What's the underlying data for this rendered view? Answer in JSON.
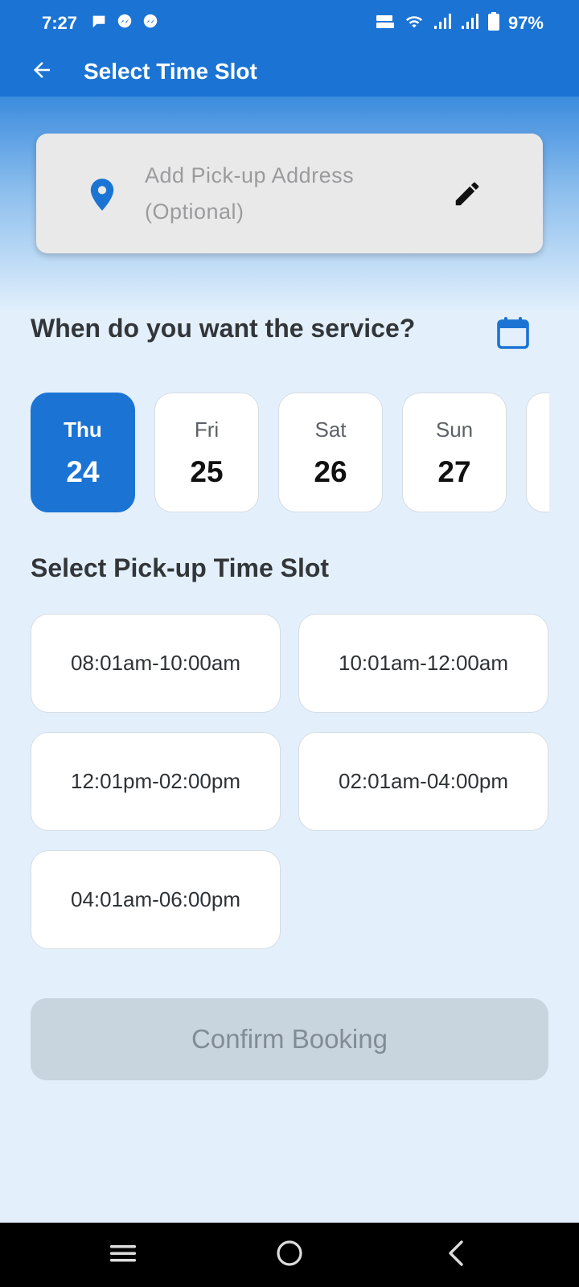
{
  "status_bar": {
    "time": "7:27",
    "battery": "97%",
    "left_icons": [
      "chat-bubble-icon",
      "messenger-icon",
      "messenger-icon"
    ],
    "right_icons": [
      "volte-icon",
      "wifi-icon",
      "signal-icon",
      "signal-icon",
      "battery-icon"
    ]
  },
  "app_bar": {
    "title": "Select Time Slot",
    "back_icon": "arrow-left-icon"
  },
  "address": {
    "line1": "Add Pick-up Address",
    "line2": "(Optional)",
    "pin_icon": "location-pin-icon",
    "edit_icon": "pencil-icon"
  },
  "service_question": "When do you want the service?",
  "calendar_icon": "calendar-icon",
  "dates": [
    {
      "day": "Thu",
      "num": "24",
      "selected": true
    },
    {
      "day": "Fri",
      "num": "25",
      "selected": false
    },
    {
      "day": "Sat",
      "num": "26",
      "selected": false
    },
    {
      "day": "Sun",
      "num": "27",
      "selected": false
    },
    {
      "day": "",
      "num": "",
      "selected": false
    }
  ],
  "slot_heading": "Select Pick-up Time Slot",
  "slots": [
    "08:01am-10:00am",
    "10:01am-12:00am",
    "12:01pm-02:00pm",
    "02:01am-04:00pm",
    "04:01am-06:00pm"
  ],
  "confirm_label": "Confirm Booking",
  "nav_bar": {
    "icons": [
      "menu-icon",
      "home-icon",
      "back-icon"
    ]
  },
  "colors": {
    "primary": "#1b74d4",
    "background": "#e3f0fc",
    "disabled_button": "#c8d4de"
  }
}
